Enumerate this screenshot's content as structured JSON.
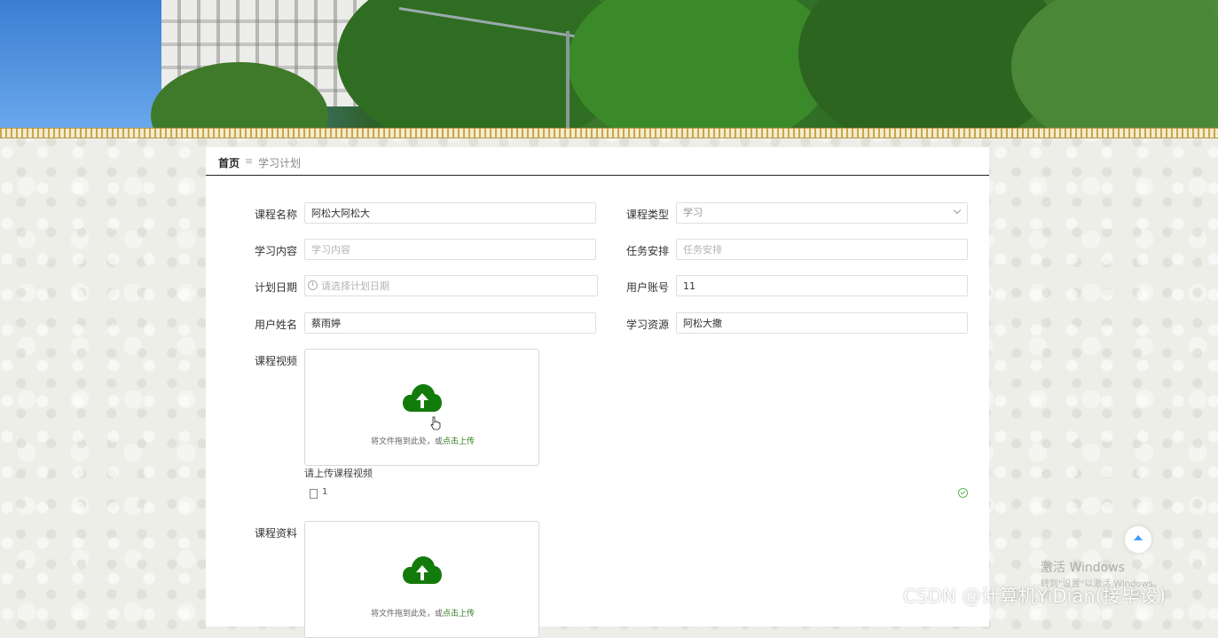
{
  "breadcrumb": {
    "home": "首页",
    "separator": "≡",
    "current": "学习计划"
  },
  "form": {
    "course_name": {
      "label": "课程名称",
      "value": "阿松大阿松大"
    },
    "course_type": {
      "label": "课程类型",
      "value": "学习"
    },
    "study_content": {
      "label": "学习内容",
      "placeholder": "学习内容"
    },
    "task_schedule": {
      "label": "任务安排",
      "placeholder": "任务安排"
    },
    "plan_date": {
      "label": "计划日期",
      "placeholder": "请选择计划日期"
    },
    "user_account": {
      "label": "用户账号",
      "value": "11"
    },
    "user_name": {
      "label": "用户姓名",
      "value": "蔡雨婷"
    },
    "study_resource": {
      "label": "学习资源",
      "value": "阿松大撒"
    },
    "course_video": {
      "label": "课程视频",
      "upload_text": "将文件拖到此处，或",
      "upload_link": "点击上传",
      "hint": "请上传课程视频",
      "file_name": "1"
    },
    "course_material": {
      "label": "课程资料",
      "upload_text": "将文件拖到此处，或",
      "upload_link": "点击上传"
    }
  },
  "colors": {
    "accent": "#2d7a19",
    "upload_icon": "#137b0b",
    "backtop": "#409eff"
  },
  "watermark": {
    "line1": "激活 Windows",
    "line2": "转到\"设置\"以激活 Windows。"
  },
  "csdn": "CSDN @计算机YiDian(接毕设)"
}
